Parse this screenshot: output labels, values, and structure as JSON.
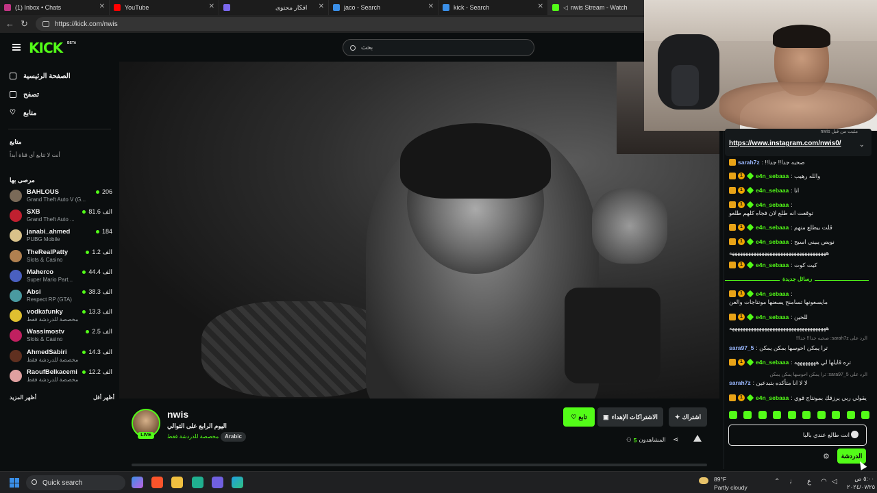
{
  "browser": {
    "tabs": [
      {
        "title": "(1) Inbox • Chats",
        "color": "#c13584"
      },
      {
        "title": "YouTube",
        "color": "#ff0000"
      },
      {
        "title": "افكار محتوى",
        "color": "#7b68ee"
      },
      {
        "title": "jaco - Search",
        "color": "#3a8fe8"
      },
      {
        "title": "kick - Search",
        "color": "#3a8fe8"
      },
      {
        "title": "nwis Stream - Watch",
        "color": "#53fc18"
      }
    ],
    "url": "https://kick.com/nwis"
  },
  "header": {
    "logo": "KICK",
    "beta": "BETA",
    "search_placeholder": "بحث"
  },
  "sidebar": {
    "nav": [
      {
        "label": "الصفحة الرئيسية",
        "icon": "home-icon"
      },
      {
        "label": "تصفح",
        "icon": "browse-icon"
      },
      {
        "label": "متابع",
        "icon": "heart-icon"
      }
    ],
    "following_title": "متابع",
    "following_empty": "أنت لا تتابع أي قناة أبداً",
    "recommended_title": "مرصى بها",
    "channels": [
      {
        "name": "BAHLOUS",
        "category": "Grand Theft Auto V (G...",
        "viewers": "206",
        "color": "#7a6a58"
      },
      {
        "name": "SXB",
        "category": "Grand Theft Auto ...",
        "viewers": "81.6 الف",
        "color": "#c02030"
      },
      {
        "name": "janabi_ahmed",
        "category": "PUBG Mobile",
        "viewers": "184",
        "color": "#d8c18a"
      },
      {
        "name": "TheRealPatty",
        "category": "Slots & Casino",
        "viewers": "1.2 الف",
        "color": "#b08050"
      },
      {
        "name": "Maherco",
        "category": "Super Mario Part...",
        "viewers": "44.4 الف",
        "color": "#4a60c0"
      },
      {
        "name": "Absi",
        "category": "Respect RP (GTA)",
        "viewers": "38.3 الف",
        "color": "#4a9aa0"
      },
      {
        "name": "vodkafunky",
        "category": "مخصصة للدردشة فقط",
        "viewers": "13.3 الف",
        "color": "#e0c030"
      },
      {
        "name": "Wassimostv",
        "category": "Slots & Casino",
        "viewers": "2.5 الف",
        "color": "#c02060"
      },
      {
        "name": "AhmedSabiri",
        "category": "مخصصة للدردشة فقط",
        "viewers": "14.3 الف",
        "color": "#603020"
      },
      {
        "name": "RaoufBelkacemi",
        "category": "مخصصة للدردشة فقط",
        "viewers": "12.2 الف",
        "color": "#e0a0a0"
      }
    ],
    "show_more": "أظهر المزيد",
    "show_less": "أظهر أقل"
  },
  "stream": {
    "streamer": "nwis",
    "title": "اليوم الرابع على التوالي",
    "category": "مخصصة للدردشة فقط",
    "language": "Arabic",
    "live": "LIVE",
    "follow": "تابع",
    "gift_subs": "الاشتراكات الإهداء",
    "subscribe": "اشتراك",
    "viewers_label": "المشاهدون",
    "viewers_count": "5"
  },
  "chat": {
    "pinned_by": "مثبت من قبل nwis",
    "pinned_link": "https://www.instagram.com/nwis0/",
    "new_messages": "رسائل جديدة",
    "messages": [
      {
        "user": "sarah7z",
        "text": "صحبه جدا!! جدا!!",
        "style": "blue",
        "badges": 1
      },
      {
        "user": "e4n_sebaaa",
        "text": "والله رهيب",
        "style": "green",
        "badges": 3
      },
      {
        "user": "e4n_sebaaa",
        "text": "انا",
        "style": "green",
        "badges": 3
      },
      {
        "user": "e4n_sebaaa",
        "text": "توقعت انه طلع لان فجاه كلهم طلعو",
        "style": "green",
        "badges": 3
      },
      {
        "user": "e4n_sebaaa",
        "text": "قلت بيطلع منهم",
        "style": "green",
        "badges": 3
      },
      {
        "user": "e4n_sebaaa",
        "text": "نويص يبيني اسبح",
        "style": "green",
        "badges": 3
      },
      {
        "user": "",
        "text": "ههههههههههههههههههههههههههههههههههههه",
        "style": "plain",
        "badges": 0
      },
      {
        "user": "e4n_sebaaa",
        "text": "كيت كوت",
        "style": "green",
        "badges": 3
      },
      {
        "user": "e4n_sebaaa",
        "text": "مايسعونها تسامنح يسعنها مونتاجات والعن",
        "style": "green",
        "badges": 3
      },
      {
        "user": "e4n_sebaaa",
        "text": "للحين",
        "style": "green",
        "badges": 3
      },
      {
        "user": "",
        "text": "ههههههههههههههههههههههههههههههههههههه",
        "style": "plain",
        "badges": 0
      },
      {
        "user": "sara97_5",
        "text": "ترا يمكن احوسها بمكن يمكن",
        "style": "blue",
        "badges": 0
      },
      {
        "user": "e4n_sebaaa",
        "text": "تره قايلها لي ههههههههه",
        "style": "green",
        "badges": 3
      },
      {
        "user": "sarah7z",
        "text": "لا لا انا متأكده بتبدعين",
        "style": "blue",
        "badges": 0
      },
      {
        "user": "e4n_sebaaa",
        "text": "يقولي ربي يرزقك بمونتاج قوي",
        "style": "green",
        "badges": 3
      }
    ],
    "replies": [
      "الرد على sarah7z: صحبه جدا!! جدا!!",
      "الرد على sara97_5: ترا يمكن احوسها يمكن يمكن"
    ],
    "input_value": "انت طالع عندي بالبا",
    "send_label": "الدردشة"
  },
  "taskbar": {
    "search": "Quick search",
    "temp": "89°F",
    "condition": "Partly cloudy",
    "time": "٥:٠٠ ص",
    "date": "٢٠٢٤/٠٧/٢٥",
    "lang": "ع"
  }
}
